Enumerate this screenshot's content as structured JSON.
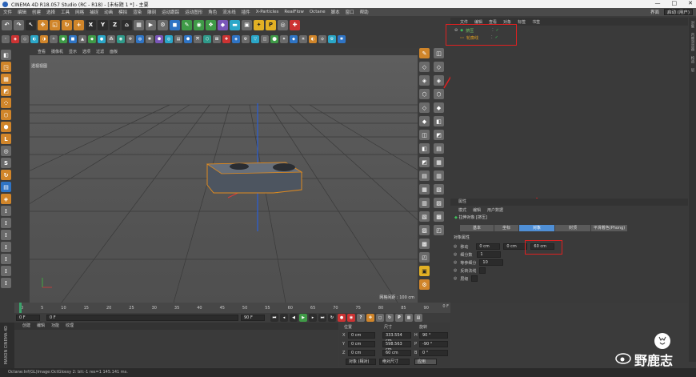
{
  "window": {
    "title": "CINEMA 4D R18.057 Studio (RC - R18) - [未标题 1 *] - 主要",
    "min": "—",
    "max": "□",
    "close": "✕"
  },
  "menu": {
    "items": [
      "文件",
      "编辑",
      "创建",
      "选择",
      "工具",
      "网格",
      "捕捉",
      "动画",
      "模拟",
      "渲染",
      "雕刻",
      "运动跟踪",
      "运动图形",
      "角色",
      "流水线",
      "插件",
      "X-Particles",
      "RealFlow",
      "Octane",
      "脚本",
      "窗口",
      "帮助"
    ],
    "layout_label": "界面",
    "layout_value": "启动 (用户)"
  },
  "viewport": {
    "menu": [
      "查看",
      "摄像机",
      "显示",
      "选项",
      "过滤",
      "面板"
    ],
    "label": "透视视图",
    "grid_info": "网格间距 : 100 cm"
  },
  "object_manager": {
    "tabs": [
      "文件",
      "编辑",
      "查看",
      "对象",
      "标签",
      "书签"
    ],
    "objects": [
      {
        "name": "挤压",
        "color": "#3fbf5a"
      },
      {
        "name": "轮廓线",
        "color": "#e0a020"
      }
    ]
  },
  "side_tabs": [
    "对象",
    "内容浏览器",
    "构造",
    "层"
  ],
  "attribute_manager": {
    "title": "属性",
    "subtabs": [
      "模式",
      "编辑",
      "用户数据"
    ],
    "object_title": "拉伸对象 [挤压]",
    "tabs": [
      "基本",
      "坐标",
      "对象",
      "封顶",
      "平滑着色(Phong)"
    ],
    "active_tab": "对象",
    "section": "对象属性",
    "props": {
      "move_label": "移动",
      "move_x": "0 cm",
      "move_y": "0 cm",
      "move_z": "60 cm",
      "subdiv_label": "细分数",
      "subdiv_value": "1",
      "iso_label": "等参细分",
      "iso_value": "10",
      "flip_label": "反转法线",
      "hier_label": "层级"
    }
  },
  "timeline": {
    "ticks": [
      "0",
      "5",
      "10",
      "15",
      "20",
      "25",
      "30",
      "35",
      "40",
      "45",
      "50",
      "55",
      "60",
      "65",
      "70",
      "75",
      "80",
      "85",
      "90"
    ],
    "end_label": "0 F",
    "current_frame": "0 F",
    "start_field": "0 F",
    "end_field": "90 F",
    "end_field2": "90 F"
  },
  "material_manager": {
    "tabs": [
      "创建",
      "编辑",
      "功能",
      "纹理"
    ]
  },
  "coords": {
    "headers": [
      "位置",
      "尺寸",
      "旋转"
    ],
    "rows": [
      {
        "axis": "X",
        "pos": "0 cm",
        "size": "333.554 cm",
        "rot_label": "H",
        "rot": "90 °"
      },
      {
        "axis": "Y",
        "pos": "0 cm",
        "size": "598.563 cm",
        "rot_label": "P",
        "rot": "-90 °"
      },
      {
        "axis": "Z",
        "pos": "0 cm",
        "size": "60 cm",
        "rot_label": "B",
        "rot": "0 °"
      }
    ],
    "mode1": "对象 (相对)",
    "mode2": "绝对尺寸",
    "apply": "应用"
  },
  "maxon": "MAXON CINEMA 4D",
  "status": "Octane:Inf(GL)Image:OctGlossy 2: bit:-1 res=1   145.141 ms.",
  "watermark": "野鹿志",
  "colors": {
    "accent": "#4f8fd6",
    "highlight_box": "#e02020",
    "bg": "#3b3b3b",
    "panel": "#3a3a3a"
  }
}
